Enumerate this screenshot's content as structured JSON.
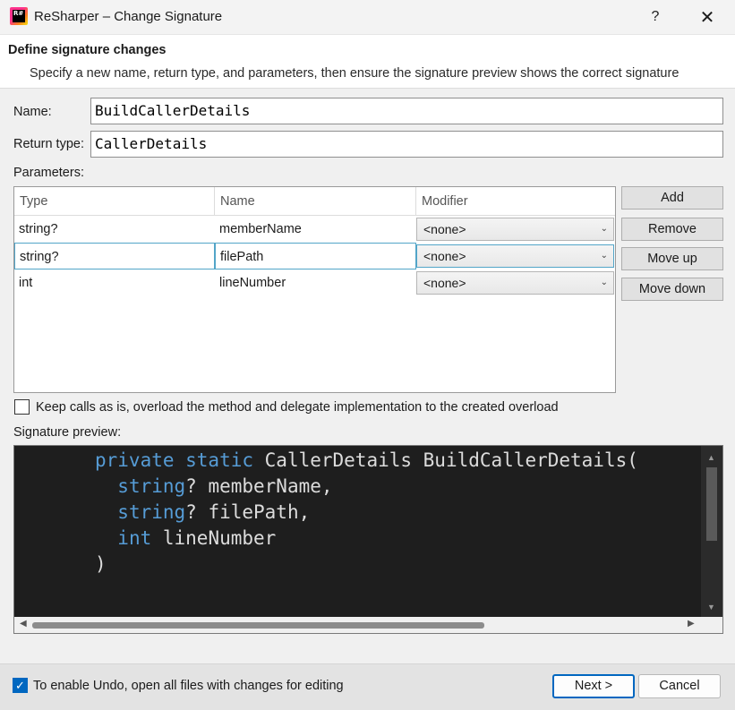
{
  "window": {
    "title": "ReSharper – Change Signature",
    "help": "?",
    "close": "✕",
    "app_icon_text": "R#"
  },
  "header": {
    "title": "Define signature changes",
    "subtitle": "Specify a new name, return type, and parameters, then ensure the signature preview shows the correct signature"
  },
  "form": {
    "name_label": "Name:",
    "name_value": "BuildCallerDetails",
    "return_label": "Return type:",
    "return_value": "CallerDetails",
    "params_label": "Parameters:"
  },
  "parameters": {
    "columns": [
      "Type",
      "Name",
      "Modifier"
    ],
    "rows": [
      {
        "type": "string?",
        "name": "memberName",
        "modifier": "<none>"
      },
      {
        "type": "string?",
        "name": "filePath",
        "modifier": "<none>"
      },
      {
        "type": "int",
        "name": "lineNumber",
        "modifier": "<none>"
      }
    ],
    "selected_row": 1
  },
  "side_buttons": {
    "add": "Add",
    "remove": "Remove",
    "move_up": "Move up",
    "move_down": "Move down"
  },
  "overload": {
    "checked": false,
    "label": "Keep calls as is, overload the method and delegate implementation to the created overload"
  },
  "preview": {
    "label": "Signature preview:",
    "line1_kw": "private static",
    "line1_rest": " CallerDetails BuildCallerDetails(",
    "params": [
      {
        "kw": "string",
        "rest": "? memberName,"
      },
      {
        "kw": "string",
        "rest": "? filePath,"
      },
      {
        "kw": "int",
        "rest": " lineNumber"
      }
    ],
    "close": ")"
  },
  "footer": {
    "undo_checked": true,
    "undo_label": "To enable Undo, open all files with changes for editing",
    "next": "Next >",
    "cancel": "Cancel"
  },
  "colors": {
    "keyword": "#569cd6",
    "accent": "#0067c0",
    "preview_bg": "#1e1e1e"
  }
}
